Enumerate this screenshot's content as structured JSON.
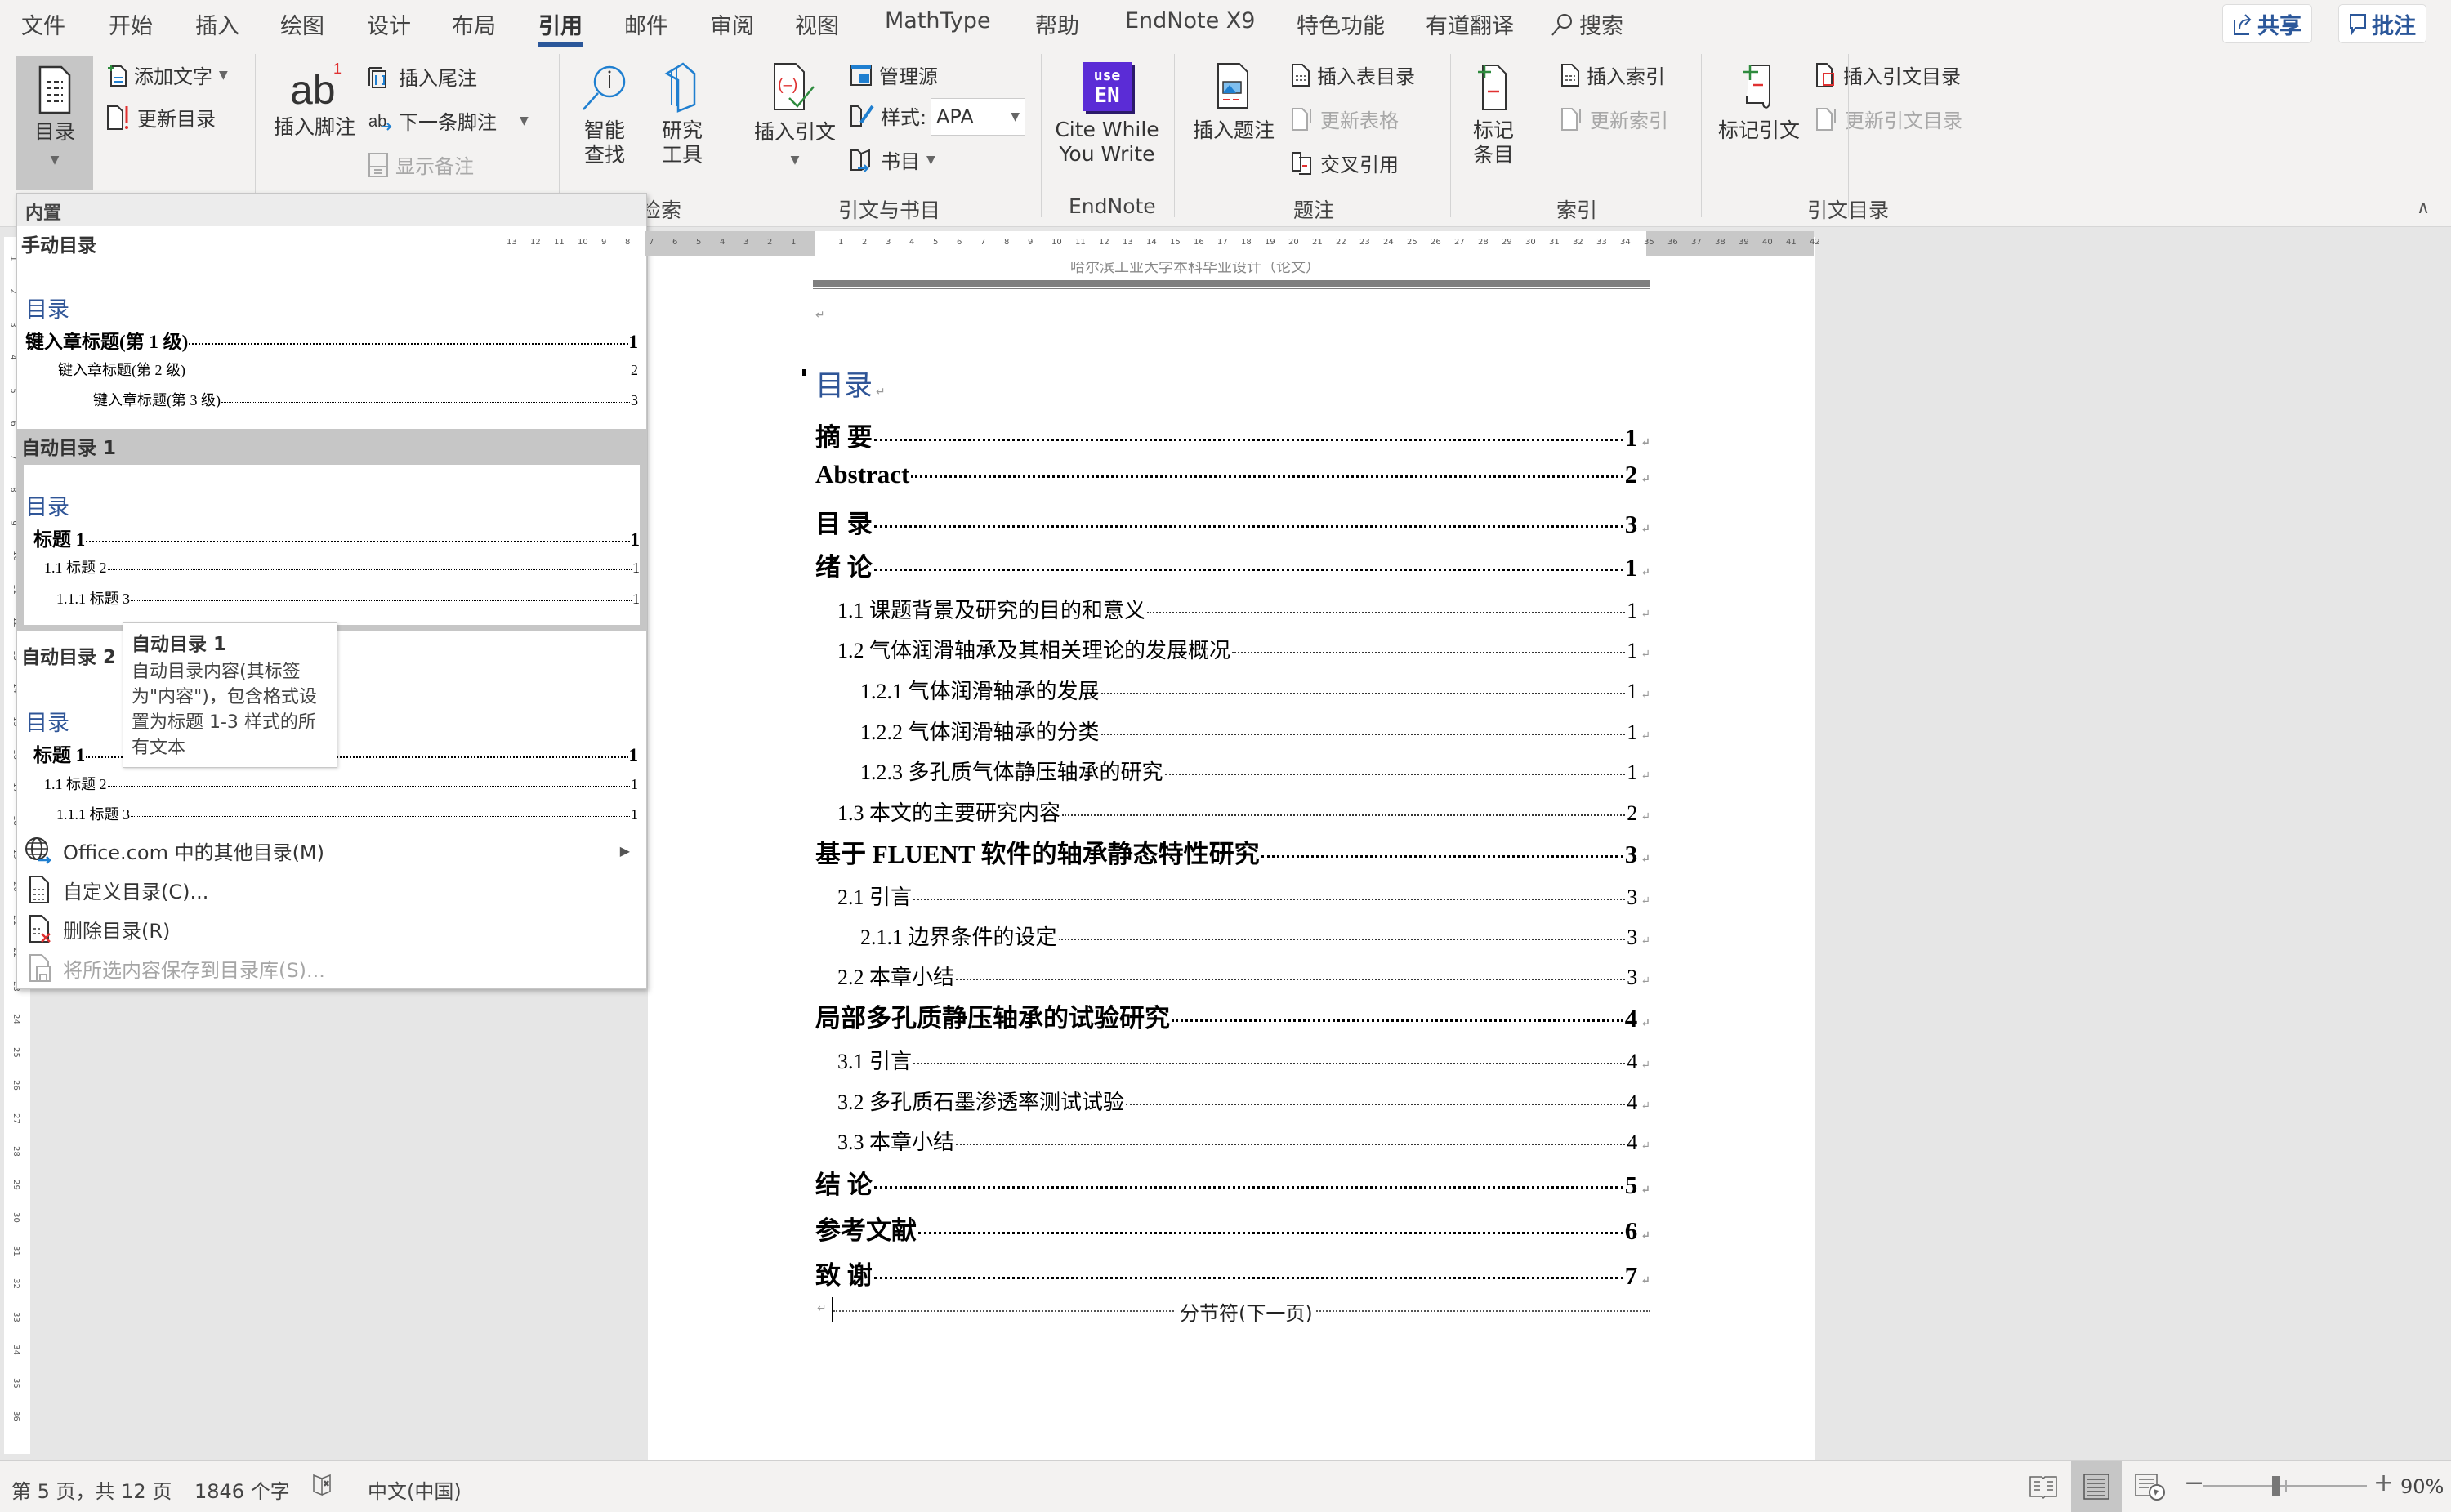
{
  "menu_tabs": [
    "文件",
    "开始",
    "插入",
    "绘图",
    "设计",
    "布局",
    "引用",
    "邮件",
    "审阅",
    "视图",
    "MathType",
    "帮助",
    "EndNote X9",
    "特色功能",
    "有道翻译"
  ],
  "active_tab": "引用",
  "search_label": "搜索",
  "share_label": "共享",
  "comments_label": "批注",
  "ribbon": {
    "toc_group": {
      "toc_button": "目录",
      "add_text": "添加文字",
      "update_toc": "更新目录"
    },
    "footnotes_group": {
      "insert_footnote": "插入脚注",
      "insert_endnote": "插入尾注",
      "next_footnote": "下一条脚注",
      "show_notes": "显示备注"
    },
    "research_group": {
      "smart_lookup": "智能\n查找",
      "researcher": "研究\n工具",
      "label": "检索"
    },
    "citations_group": {
      "insert_citation": "插入引文",
      "manage_sources": "管理源",
      "style_label": "样式:",
      "style_value": "APA",
      "bibliography": "书目",
      "label": "引文与书目"
    },
    "endnote_group": {
      "badge_top": "use",
      "badge_bottom": "EN",
      "cite_while_you_write": "Cite While\nYou Write",
      "label": "EndNote"
    },
    "captions_group": {
      "insert_caption": "插入题注",
      "insert_table_of_figures": "插入表目录",
      "update_table": "更新表格",
      "cross_reference": "交叉引用",
      "label": "题注"
    },
    "index_group": {
      "mark_entry": "标记\n条目",
      "insert_index": "插入索引",
      "update_index": "更新索引",
      "label": "索引"
    },
    "authorities_group": {
      "mark_citation": "标记引文",
      "insert_table_of_authorities": "插入引文目录",
      "update_table_of_authorities": "更新引文目录",
      "label": "引文目录"
    }
  },
  "gallery": {
    "header": "内置",
    "manual": {
      "name": "手动目录",
      "title": "目录",
      "rows": [
        {
          "text": "键入章标题(第 1 级)",
          "page": "1"
        },
        {
          "text": "键入章标题(第 2 级)",
          "page": "2"
        },
        {
          "text": "键入章标题(第 3 级)",
          "page": "3"
        }
      ]
    },
    "auto1": {
      "name": "自动目录 1",
      "title": "目录",
      "rows": [
        {
          "text": "标题 1",
          "page": "1"
        },
        {
          "text": "1.1 标题 2",
          "page": "1"
        },
        {
          "text": "1.1.1 标题 3",
          "page": "1"
        }
      ]
    },
    "auto2": {
      "name": "自动目录 2",
      "title": "目录",
      "rows": [
        {
          "text": "标题 1",
          "page": "1"
        },
        {
          "text": "1.1 标题 2",
          "page": "1"
        },
        {
          "text": "1.1.1 标题 3",
          "page": "1"
        }
      ]
    },
    "menu": [
      {
        "label": "Office.com 中的其他目录(M)",
        "disabled": false,
        "submenu": true
      },
      {
        "label": "自定义目录(C)...",
        "disabled": false
      },
      {
        "label": "删除目录(R)",
        "disabled": false
      },
      {
        "label": "将所选内容保存到目录库(S)...",
        "disabled": true
      }
    ]
  },
  "tooltip": {
    "title": "自动目录 1",
    "body": "自动目录内容(其标签为\"内容\")，包含格式设置为标题 1-3 样式的所有文本"
  },
  "document": {
    "header_text": "哈尔滨工业大学本科毕业设计（论文）",
    "toc_title": "目录",
    "toc": [
      {
        "level": 1,
        "text": "摘  要",
        "page": "1"
      },
      {
        "level": 1,
        "text": "Abstract",
        "page": "2"
      },
      {
        "level": 1,
        "text": "目  录",
        "page": "3"
      },
      {
        "level": 1,
        "text": "绪  论",
        "page": "1"
      },
      {
        "level": 2,
        "text": "1.1 课题背景及研究的目的和意义",
        "page": "1"
      },
      {
        "level": 2,
        "text": "1.2 气体润滑轴承及其相关理论的发展概况",
        "page": "1"
      },
      {
        "level": 3,
        "text": "1.2.1 气体润滑轴承的发展",
        "page": "1"
      },
      {
        "level": 3,
        "text": "1.2.2 气体润滑轴承的分类",
        "page": "1"
      },
      {
        "level": 3,
        "text": "1.2.3 多孔质气体静压轴承的研究",
        "page": "1"
      },
      {
        "level": 2,
        "text": "1.3 本文的主要研究内容",
        "page": "2"
      },
      {
        "level": 1,
        "text": "基于 FLUENT 软件的轴承静态特性研究",
        "page": "3"
      },
      {
        "level": 2,
        "text": "2.1 引言",
        "page": "3"
      },
      {
        "level": 3,
        "text": "2.1.1 边界条件的设定",
        "page": "3"
      },
      {
        "level": 2,
        "text": "2.2 本章小结",
        "page": "3"
      },
      {
        "level": 1,
        "text": "局部多孔质静压轴承的试验研究",
        "page": "4"
      },
      {
        "level": 2,
        "text": "3.1 引言",
        "page": "4"
      },
      {
        "level": 2,
        "text": "3.2 多孔质石墨渗透率测试试验",
        "page": "4"
      },
      {
        "level": 2,
        "text": "3.3 本章小结",
        "page": "4"
      },
      {
        "level": 1,
        "text": "结  论",
        "page": "5"
      },
      {
        "level": 1,
        "text": "参考文献",
        "page": "6"
      },
      {
        "level": 1,
        "text": "致  谢",
        "page": "7"
      }
    ],
    "section_break": "分节符(下一页)"
  },
  "status": {
    "page_info": "第 5 页，共 12 页",
    "word_count": "1846 个字",
    "language": "中文(中国)",
    "zoom": "90%",
    "zoom_level_percent": 90
  },
  "colors": {
    "accent": "#2b579a",
    "toc_heading": "#2f5597",
    "endnote_purple": "#5b2cd6"
  }
}
